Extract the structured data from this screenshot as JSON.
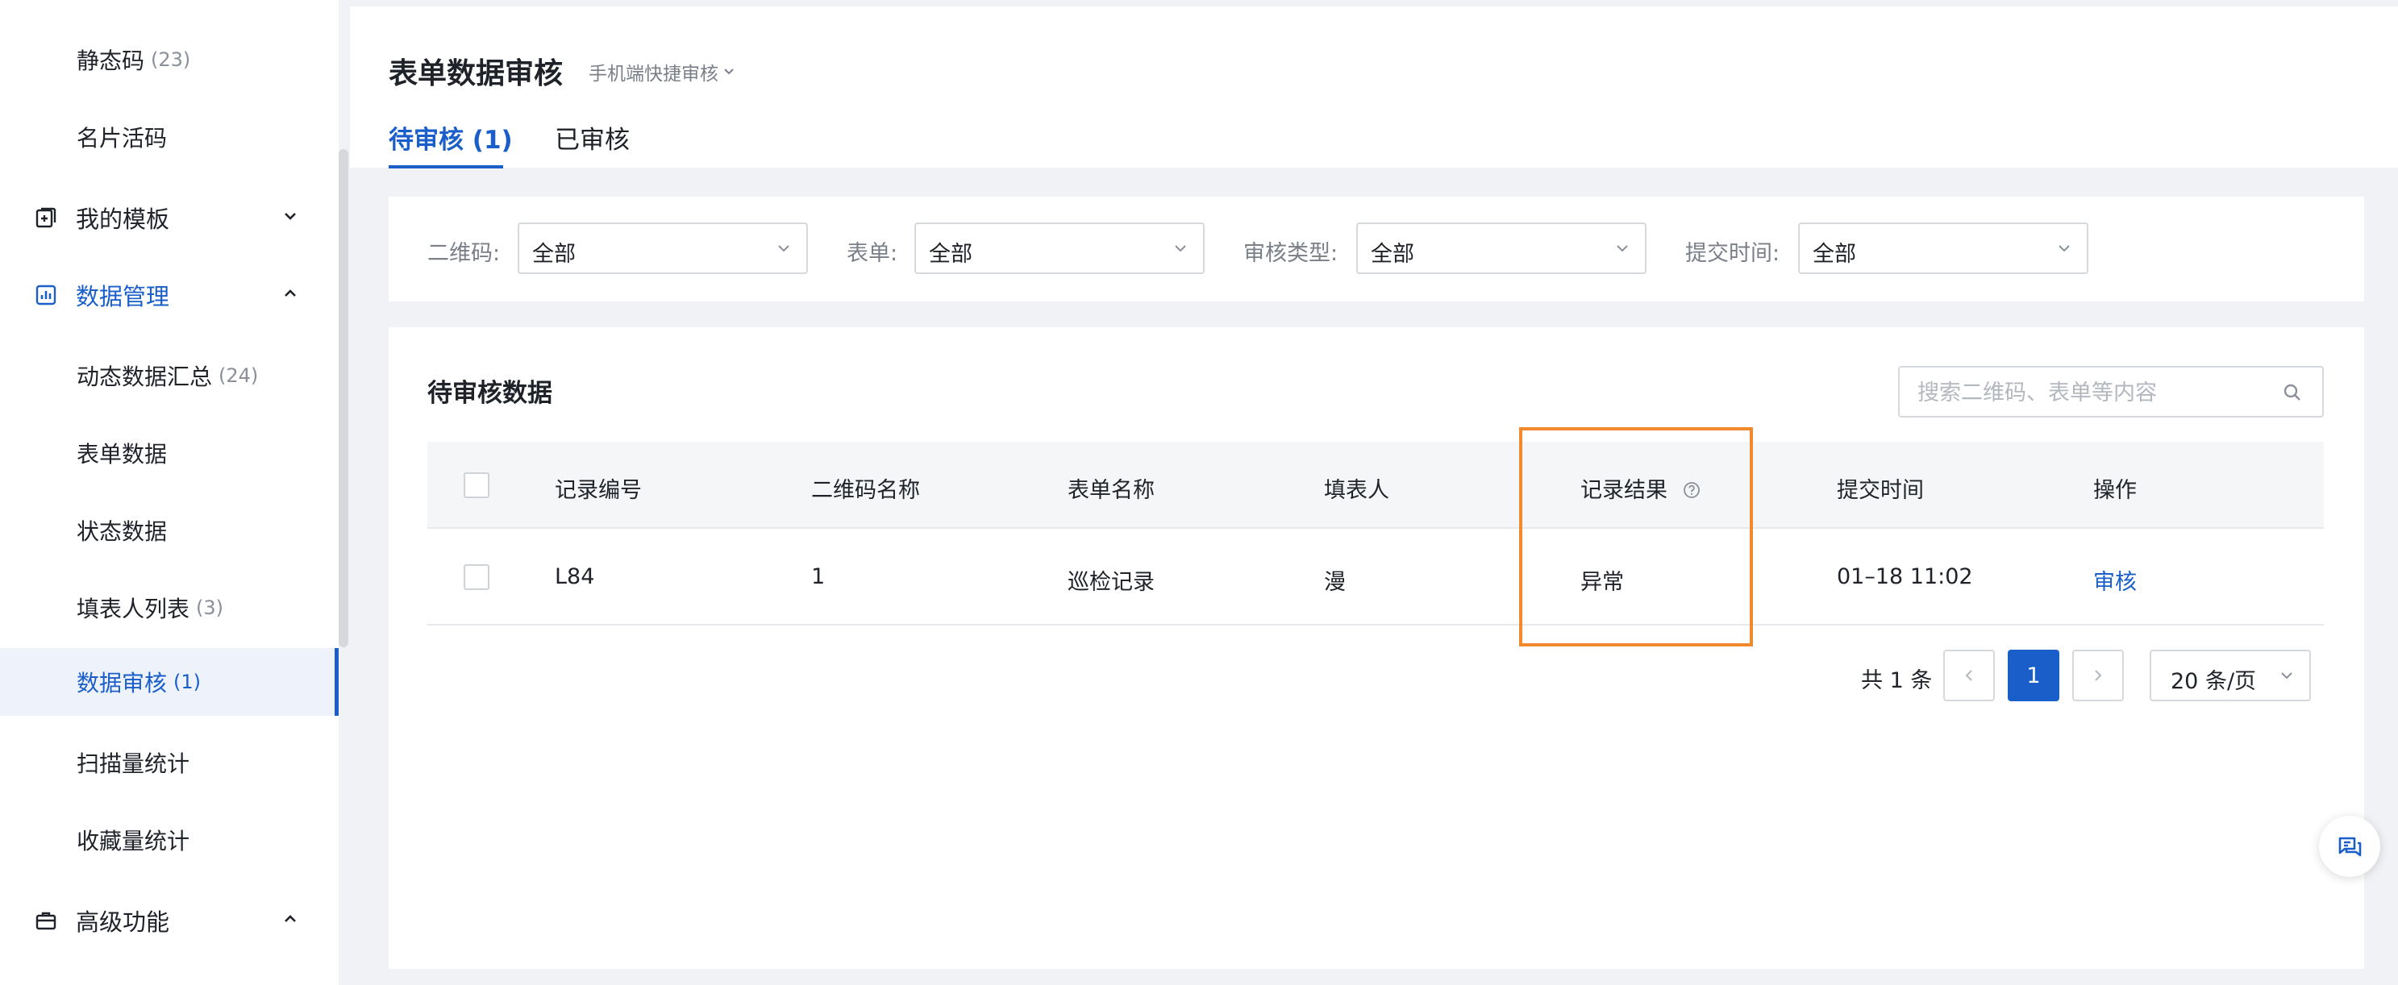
{
  "sidebar": {
    "items": [
      {
        "label": "静态码",
        "count": "(23)"
      },
      {
        "label": "名片活码",
        "count": ""
      },
      {
        "label": "动态数据汇总",
        "count": "(24)"
      },
      {
        "label": "表单数据",
        "count": ""
      },
      {
        "label": "状态数据",
        "count": ""
      },
      {
        "label": "填表人列表",
        "count": "(3)"
      },
      {
        "label": "数据审核",
        "count": "(1)"
      },
      {
        "label": "扫描量统计",
        "count": ""
      },
      {
        "label": "收藏量统计",
        "count": ""
      }
    ],
    "groups": {
      "templates": "我的模板",
      "data_mgmt": "数据管理",
      "advanced": "高级功能"
    }
  },
  "header": {
    "title": "表单数据审核",
    "subtitle": "手机端快捷审核",
    "tabs": [
      {
        "label": "待审核 (1)"
      },
      {
        "label": "已审核"
      }
    ]
  },
  "filters": [
    {
      "label": "二维码:",
      "value": "全部"
    },
    {
      "label": "表单:",
      "value": "全部"
    },
    {
      "label": "审核类型:",
      "value": "全部"
    },
    {
      "label": "提交时间:",
      "value": "全部"
    }
  ],
  "main": {
    "card_title": "待审核数据",
    "search_placeholder": "搜索二维码、表单等内容",
    "columns": [
      "记录编号",
      "二维码名称",
      "表单名称",
      "填表人",
      "记录结果",
      "提交时间",
      "操作"
    ],
    "rows": [
      {
        "id": "L84",
        "qr_name": "1",
        "form_name": "巡检记录",
        "filler": "漫",
        "result": "异常",
        "time": "01–18 11:02",
        "action": "审核"
      }
    ]
  },
  "pagination": {
    "total": "共 1 条",
    "current": "1",
    "page_size": "20 条/页"
  },
  "colors": {
    "accent": "#1a5fc9",
    "highlight": "#f18a2e"
  }
}
